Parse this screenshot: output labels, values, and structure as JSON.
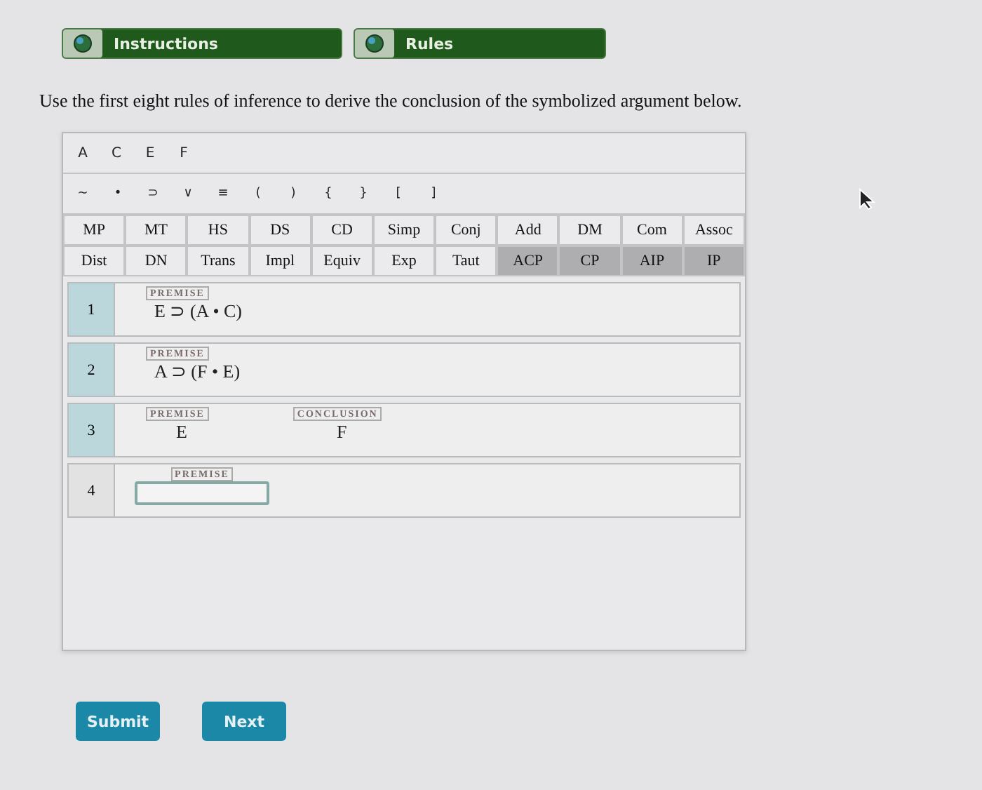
{
  "tabs": [
    {
      "label": "Instructions"
    },
    {
      "label": "Rules"
    }
  ],
  "instruction": "Use the first eight rules of inference to derive the conclusion of the symbolized argument below.",
  "letters": [
    "A",
    "C",
    "E",
    "F"
  ],
  "symbols": [
    "~",
    "•",
    "⊃",
    "∨",
    "≡",
    "(",
    ")",
    "{",
    "}",
    "[",
    "]"
  ],
  "rules": [
    [
      {
        "label": "MP",
        "kind": "rule"
      },
      {
        "label": "MT",
        "kind": "rule"
      },
      {
        "label": "HS",
        "kind": "rule"
      },
      {
        "label": "DS",
        "kind": "rule"
      },
      {
        "label": "CD",
        "kind": "rule"
      },
      {
        "label": "Simp",
        "kind": "rule"
      },
      {
        "label": "Conj",
        "kind": "rule"
      },
      {
        "label": "Add",
        "kind": "rule"
      },
      {
        "label": "DM",
        "kind": "rule"
      },
      {
        "label": "Com",
        "kind": "rule"
      },
      {
        "label": "Assoc",
        "kind": "rule"
      }
    ],
    [
      {
        "label": "Dist",
        "kind": "rule"
      },
      {
        "label": "DN",
        "kind": "rule"
      },
      {
        "label": "Trans",
        "kind": "rule"
      },
      {
        "label": "Impl",
        "kind": "rule"
      },
      {
        "label": "Equiv",
        "kind": "rule"
      },
      {
        "label": "Exp",
        "kind": "rule"
      },
      {
        "label": "Taut",
        "kind": "rule"
      },
      {
        "label": "ACP",
        "kind": "proof"
      },
      {
        "label": "CP",
        "kind": "proof"
      },
      {
        "label": "AIP",
        "kind": "proof"
      },
      {
        "label": "IP",
        "kind": "proof"
      }
    ]
  ],
  "lines": [
    {
      "number": "1",
      "tag": "PREMISE",
      "formula": "E ⊃ (A • C)",
      "kind": "given"
    },
    {
      "number": "2",
      "tag": "PREMISE",
      "formula": "A ⊃ (F • E)",
      "kind": "given"
    },
    {
      "number": "3",
      "tag": "PREMISE",
      "formula": "E",
      "conclusion_tag": "CONCLUSION",
      "conclusion": "F",
      "kind": "given"
    },
    {
      "number": "4",
      "tag": "PREMISE",
      "kind": "input"
    }
  ],
  "buttons": [
    "Submit",
    "Next"
  ]
}
